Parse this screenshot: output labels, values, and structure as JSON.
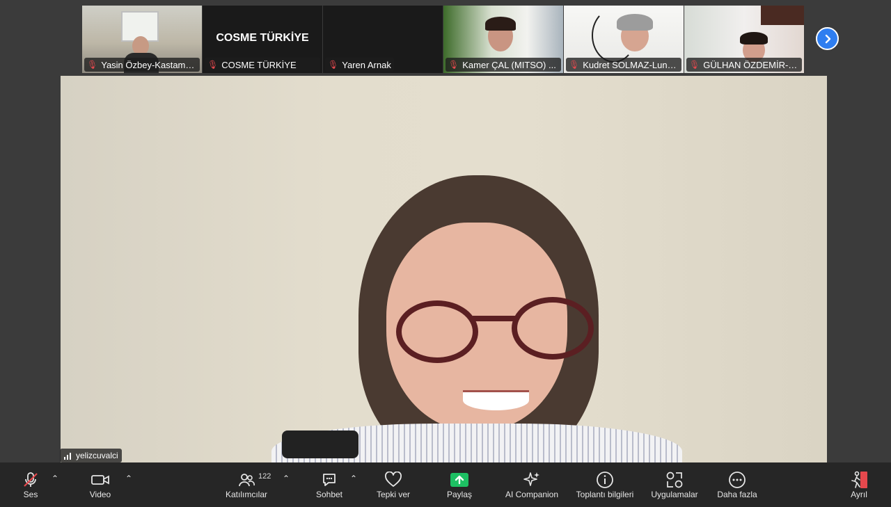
{
  "thumbnails": [
    {
      "name": "Yasin Özbey-Kastamo...",
      "muted": true
    },
    {
      "name": "COSME TÜRKİYE",
      "muted": true,
      "title_text": "COSME TÜRKİYE"
    },
    {
      "name": "Yaren Arnak",
      "muted": true
    },
    {
      "name": "Kamer ÇAL (MITSO) ...",
      "muted": true
    },
    {
      "name": "Kudret SOLMAZ-Luna...",
      "muted": true
    },
    {
      "name": "GÜLHAN ÖZDEMİR-İş...",
      "muted": true
    }
  ],
  "main_speaker": {
    "name": "yelizcuvalci"
  },
  "toolbar": {
    "audio_label": "Ses",
    "video_label": "Video",
    "participants_label": "Katılımcılar",
    "participants_count": "122",
    "chat_label": "Sohbet",
    "react_label": "Tepki ver",
    "share_label": "Paylaş",
    "ai_label": "AI Companion",
    "info_label": "Toplantı bilgileri",
    "apps_label": "Uygulamalar",
    "more_label": "Daha fazla",
    "leave_label": "Ayrıl"
  },
  "colors": {
    "background": "#3b3b3b",
    "toolbar": "#262626",
    "share_accent": "#1dc063",
    "mute_red": "#e5484d",
    "nav_blue": "#2f7ef0"
  }
}
